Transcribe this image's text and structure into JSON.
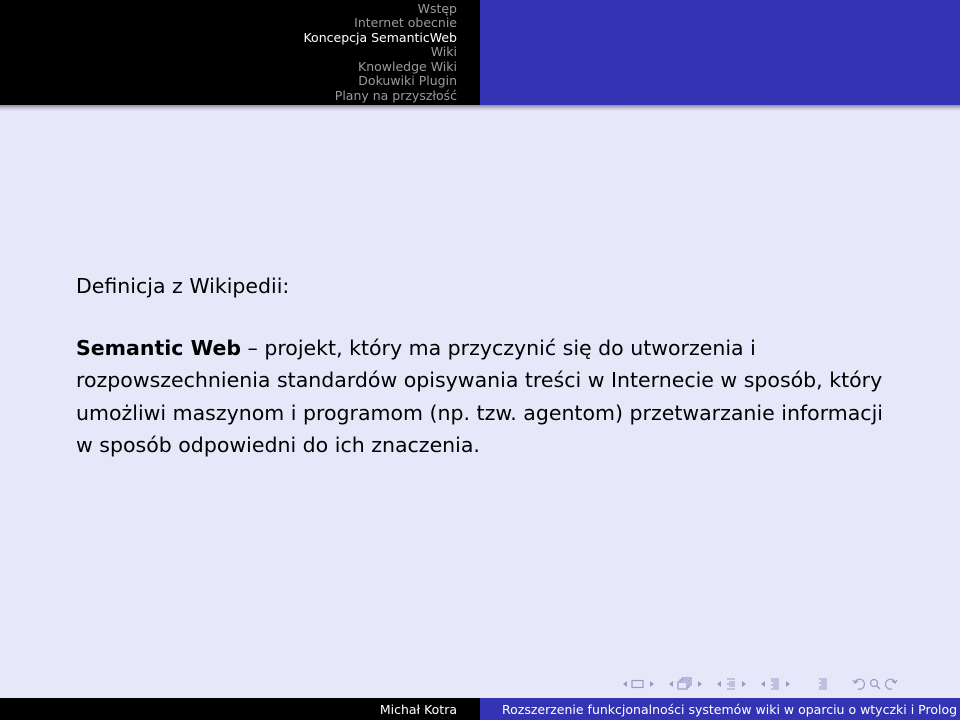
{
  "header": {
    "nav_items": [
      {
        "label": "Wstęp",
        "active": false
      },
      {
        "label": "Internet obecnie",
        "active": false
      },
      {
        "label": "Koncepcja SemanticWeb",
        "active": true
      },
      {
        "label": "Wiki",
        "active": false
      },
      {
        "label": "Knowledge Wiki",
        "active": false
      },
      {
        "label": "Dokuwiki Plugin",
        "active": false
      },
      {
        "label": "Plany na przyszłość",
        "active": false
      }
    ]
  },
  "content": {
    "intro": "Definicja z Wikipedii:",
    "term": "Semantic Web",
    "definition": " – projekt, który ma przyczynić się do utworzenia i rozpowszechnienia standardów opisywania treści w Internecie w sposób, który umożliwi maszynom i programom (np. tzw. agentom) przetwarzanie informacji w sposób odpowiedni do ich znaczenia."
  },
  "navigation_symbols": {
    "icons": [
      "arrow-left",
      "frame",
      "arrow-right",
      "arrow-left",
      "subsection",
      "arrow-right",
      "arrow-left",
      "section",
      "arrow-right",
      "arrow-left",
      "subsubsection",
      "arrow-right",
      "toc",
      "undo",
      "search",
      "redo"
    ],
    "color": "#9999c8"
  },
  "footer": {
    "author": "Michał Kotra",
    "title": "Rozszerzenie funkcjonalności systemów wiki w oparciu o wtyczki i Prolog"
  },
  "colors": {
    "header_left": "#000000",
    "header_right": "#3333b3",
    "background": "#e7e7fa",
    "active_nav": "#ffffff",
    "inactive_nav": "#9a9a9a"
  }
}
